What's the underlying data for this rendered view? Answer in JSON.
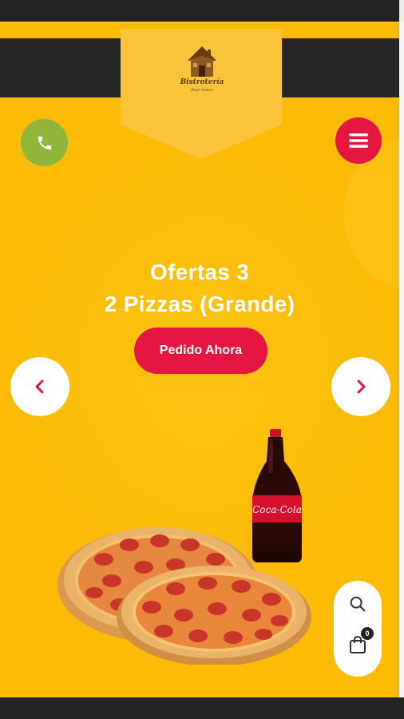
{
  "brand": {
    "name": "Bistrotería",
    "tagline": "Best Sabor",
    "logo_icon": "house-logo-icon"
  },
  "header": {
    "phone_icon": "phone-icon",
    "menu_icon": "hamburger-menu-icon"
  },
  "hero": {
    "title_line1": "Ofertas 3",
    "title_line2": "2 Pizzas (Grande)",
    "cta_label": "Pedido Ahora",
    "prev_icon": "chevron-left-icon",
    "next_icon": "chevron-right-icon",
    "bottle_label": "Coca-Cola"
  },
  "floating": {
    "search_icon": "search-icon",
    "cart_icon": "shopping-bag-icon",
    "cart_count": "0"
  },
  "colors": {
    "background": "#fbbb07",
    "accent": "#e5163f",
    "phone": "#8fb53a",
    "dark": "#262626"
  }
}
